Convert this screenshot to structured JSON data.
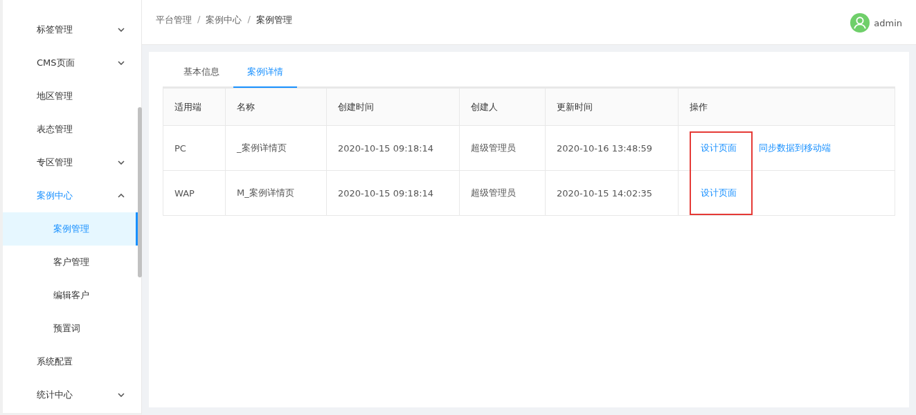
{
  "sidebar": {
    "items": [
      {
        "label": "标签管理",
        "expanded": false,
        "selected": false
      },
      {
        "label": "CMS页面",
        "expanded": false,
        "selected": false
      },
      {
        "label": "地区管理",
        "selected": false
      },
      {
        "label": "表态管理",
        "selected": false
      },
      {
        "label": "专区管理",
        "expanded": false,
        "selected": false
      },
      {
        "label": "案例中心",
        "expanded": true,
        "selected": true,
        "children": [
          {
            "label": "案例管理",
            "selected": true
          },
          {
            "label": "客户管理",
            "selected": false
          },
          {
            "label": "编辑客户",
            "selected": false
          },
          {
            "label": "预置词",
            "selected": false
          }
        ]
      },
      {
        "label": "系统配置",
        "selected": false
      },
      {
        "label": "统计中心",
        "expanded": false,
        "selected": false
      }
    ]
  },
  "breadcrumb": [
    "平台管理",
    "案例中心",
    "案例管理"
  ],
  "breadcrumb_separator": "/",
  "user": {
    "name": "admin"
  },
  "tabs": [
    {
      "label": "基本信息",
      "selected": false
    },
    {
      "label": "案例详情",
      "selected": true
    }
  ],
  "table": {
    "columns": [
      "适用端",
      "名称",
      "创建时间",
      "创建人",
      "更新时间",
      "操作"
    ],
    "rows": [
      {
        "cells": [
          "PC",
          "_案例详情页",
          "2020-10-15 09:18:14",
          "超级管理员",
          "2020-10-16 13:48:59"
        ],
        "actions": [
          "设计页面",
          "同步数据到移动端"
        ]
      },
      {
        "cells": [
          "WAP",
          "M_案例详情页",
          "2020-10-15 09:18:14",
          "超级管理员",
          "2020-10-15 14:02:35"
        ],
        "actions": [
          "设计页面"
        ]
      }
    ]
  }
}
